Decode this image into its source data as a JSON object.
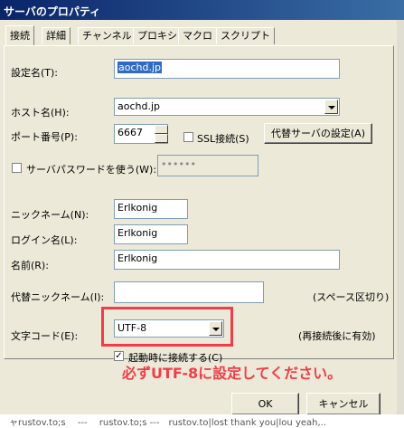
{
  "window": {
    "title": "サーバのプロパティ"
  },
  "tabs": [
    "接続",
    "詳細",
    "チャンネル",
    "プロキシ",
    "マクロ",
    "スクリプト"
  ],
  "form": {
    "setting_name": {
      "label": "設定名(T):",
      "value": "aochd.jp"
    },
    "host_name": {
      "label": "ホスト名(H):",
      "value": "aochd.jp"
    },
    "port": {
      "label": "ポート番号(P):",
      "value": "6667"
    },
    "ssl": {
      "label": "SSL接続(S)",
      "checked": false
    },
    "proxy_button": "代替サーバの設定(A)",
    "server_password": {
      "label": "サーバパスワードを使う(W):",
      "checked": false,
      "value": "••••••"
    },
    "nickname": {
      "label": "ニックネーム(N):",
      "value": "Erlkonig"
    },
    "login_name": {
      "label": "ログイン名(L):",
      "value": "Erlkonig"
    },
    "real_name": {
      "label": "名前(R):",
      "value": "Erlkonig"
    },
    "alt_nickname": {
      "label": "代替ニックネーム(I):",
      "value": "",
      "hint": "(スペース区切り)"
    },
    "charset": {
      "label": "文字コード(E):",
      "value": "UTF-8",
      "hint": "(再接続後に有効)"
    },
    "auto_connect": {
      "label": "起動時に接続する(C)",
      "checked": true
    }
  },
  "annotation": "必ずUTF-8に設定してください。",
  "buttons": {
    "ok": "OK",
    "cancel": "キャンセル"
  },
  "status_text": "　ャrustov.to;s　 --- 　rustov.to;s ---　rustov.to|lost thank you|lou yeah,.."
}
